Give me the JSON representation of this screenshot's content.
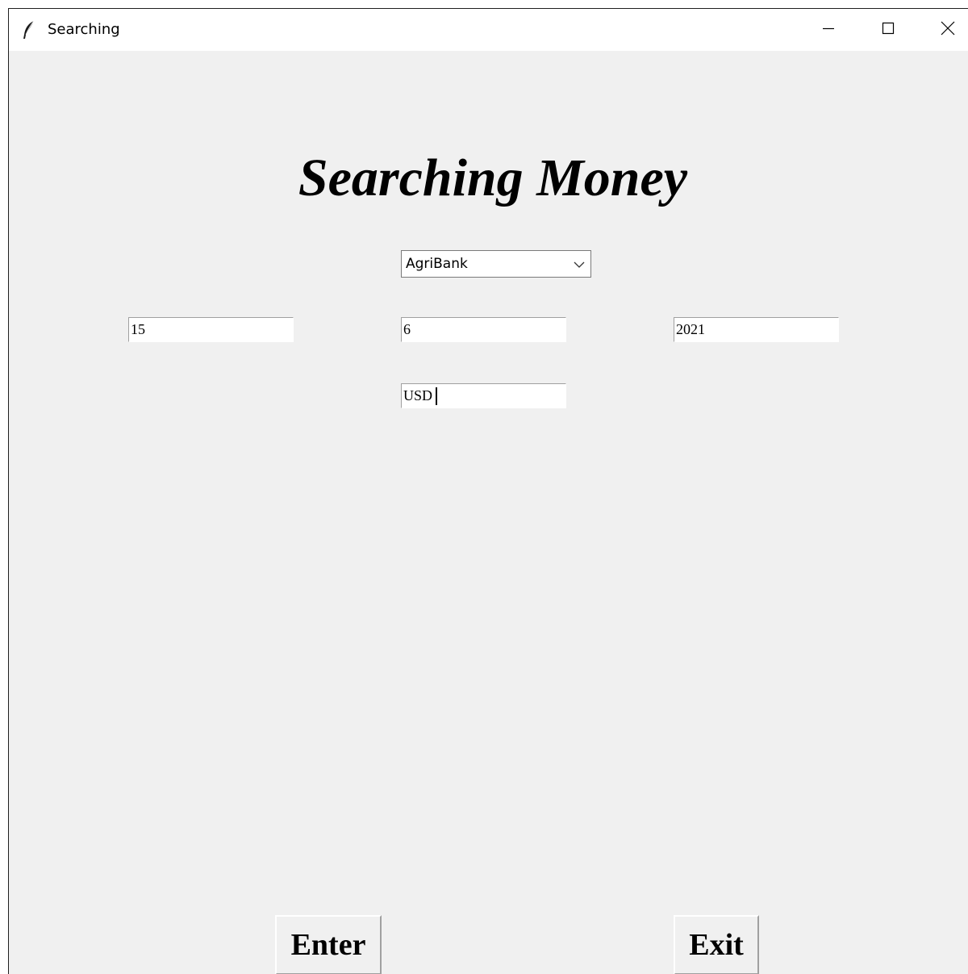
{
  "window": {
    "title": "Searching",
    "icon": "feather-icon",
    "controls": [
      "minimize-icon",
      "maximize-icon",
      "close-icon"
    ]
  },
  "main": {
    "heading": "Searching Money",
    "bank_select": {
      "selected": "AgriBank"
    },
    "date_fields": {
      "day": "15",
      "month": "6",
      "year": "2021"
    },
    "currency_field": "USD",
    "buttons": {
      "enter": "Enter",
      "exit": "Exit"
    }
  },
  "colors": {
    "background": "#f0f0f0",
    "titlebar": "#ffffff",
    "text": "#000000"
  }
}
